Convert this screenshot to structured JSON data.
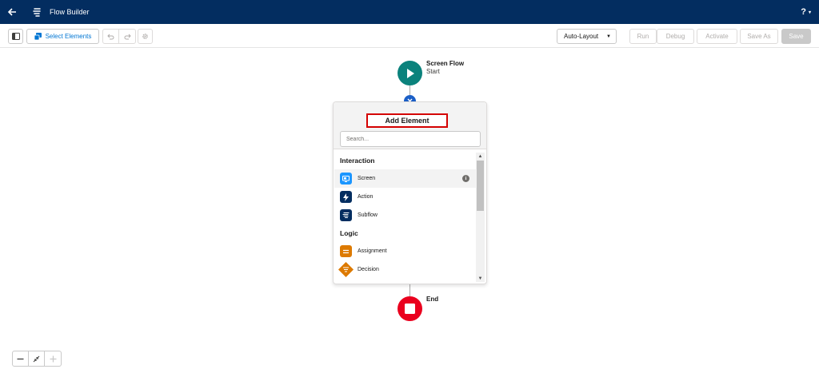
{
  "header": {
    "title": "Flow Builder",
    "back_icon": "back-arrow-icon",
    "logo_icon": "flow-icon",
    "help_label": "?",
    "help_caret": "▾",
    "background": "#032d60"
  },
  "toolbar": {
    "toggle_panel_icon": "panel-toggle-icon",
    "select_elements_label": "Select Elements",
    "undo_icon": "undo-icon",
    "redo_icon": "redo-icon",
    "settings_icon": "gear-icon",
    "layout_label": "Auto-Layout",
    "layout_caret": "▼",
    "run_label": "Run",
    "debug_label": "Debug",
    "activate_label": "Activate",
    "save_as_label": "Save As",
    "save_label": "Save"
  },
  "canvas": {
    "start": {
      "title": "Screen Flow",
      "subtitle": "Start",
      "color": "#0b827c"
    },
    "end": {
      "label": "End",
      "color": "#ea001e"
    },
    "close_color": "#1b5fc7"
  },
  "add_element_panel": {
    "title": "Add Element",
    "search_placeholder": "Search...",
    "sections": [
      {
        "title": "Interaction",
        "items": [
          {
            "label": "Screen",
            "icon": "screen-icon",
            "color": "#1b96ff",
            "info": "i"
          },
          {
            "label": "Action",
            "icon": "lightning-icon",
            "color": "#032d60"
          },
          {
            "label": "Subflow",
            "icon": "subflow-icon",
            "color": "#032d60"
          }
        ]
      },
      {
        "title": "Logic",
        "items": [
          {
            "label": "Assignment",
            "icon": "assignment-icon",
            "color": "#dd7a01"
          },
          {
            "label": "Decision",
            "icon": "decision-icon",
            "color": "#dd7a01"
          }
        ]
      }
    ]
  },
  "zoom": {
    "zoom_out_icon": "minus-icon",
    "fit_icon": "fit-view-icon",
    "zoom_in_icon": "plus-icon"
  }
}
